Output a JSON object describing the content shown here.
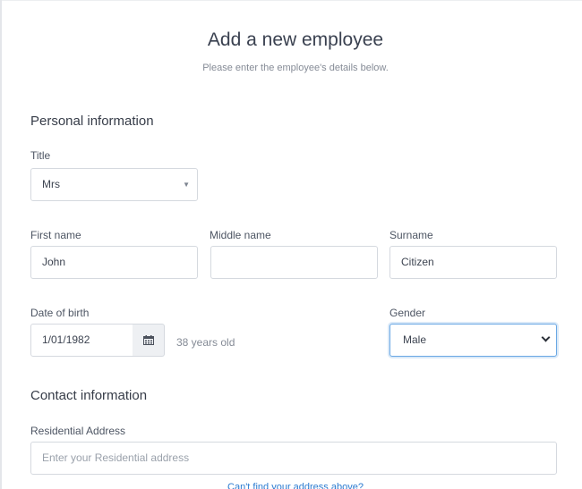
{
  "header": {
    "title": "Add a new employee",
    "subtitle": "Please enter the employee's details below."
  },
  "personal": {
    "section_title": "Personal information",
    "title_label": "Title",
    "title_value": "Mrs",
    "first_name_label": "First name",
    "first_name_value": "John",
    "middle_name_label": "Middle name",
    "middle_name_value": "",
    "surname_label": "Surname",
    "surname_value": "Citizen",
    "dob_label": "Date of birth",
    "dob_value": "1/01/1982",
    "age_text": "38 years old",
    "gender_label": "Gender",
    "gender_value": "Male"
  },
  "contact": {
    "section_title": "Contact information",
    "address_label": "Residential Address",
    "address_placeholder": "Enter your Residential address",
    "help_link": "Can't find your address above?"
  },
  "colors": {
    "focus_border": "#6aa8e4",
    "link": "#2b7bd0"
  }
}
